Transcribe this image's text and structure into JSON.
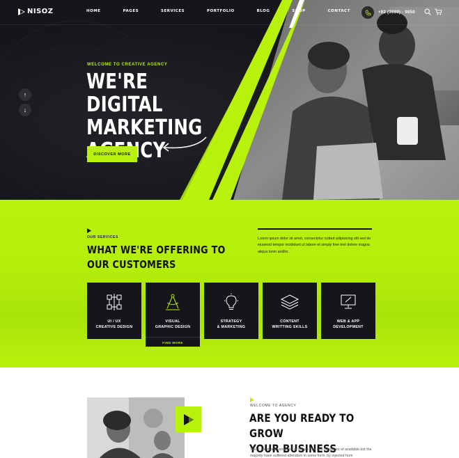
{
  "brand": {
    "name": "NISOZ",
    "accent": "#b8f20c",
    "dark": "#16161a"
  },
  "nav": {
    "items": [
      "HOME",
      "PAGES",
      "SERVICES",
      "PORTFOLIO",
      "BLOG",
      "SHOP",
      "CONTACT"
    ],
    "phone": "+92 (3680) - 9850",
    "icons": [
      "phone-icon",
      "search-icon",
      "cart-icon"
    ]
  },
  "hero": {
    "eyebrow": "WELCOME TO CREATIVE AGENCY",
    "title": "WE'RE DIGITAL MARKETING AGENCY",
    "button": "DISCOVER MORE",
    "slider_up": "↑",
    "slider_down": "↓"
  },
  "services": {
    "eyebrow": "OUR SERVICES",
    "title_line1": "WHAT WE'RE OFFERING TO",
    "title_line2": "OUR  CUSTOMERS",
    "text": "Lorem ipsum dolor sit amet, consectetur notted adipisicing elit sed do eiusmod tempor incididunt ut labore et simply free text dolore magna aliqua lonm andhn.",
    "cards": [
      {
        "label": "UI / UX\nCREATIVE DESIGN",
        "icon": "ux-flow-icon"
      },
      {
        "label": "VISUAL\nGRAPHIC DESIGN",
        "icon": "compass-icon",
        "link": "FIND MORE"
      },
      {
        "label": "STRATEGY\n& MARKETING",
        "icon": "lightbulb-icon"
      },
      {
        "label": "CONTENT\nWRITTING SKILLS",
        "icon": "layers-icon"
      },
      {
        "label": "WEB & APP\nDEVELOPMENT",
        "icon": "monitor-icon"
      }
    ]
  },
  "about": {
    "eyebrow": "WELCOME TO AGENCY",
    "title_line1": "ARE YOU READY TO GROW",
    "title_line2": "YOUR BUSINESS",
    "text": "There are many variations of simply free text passages of available but the majority have suffered alteration in some form, by injected hum"
  }
}
